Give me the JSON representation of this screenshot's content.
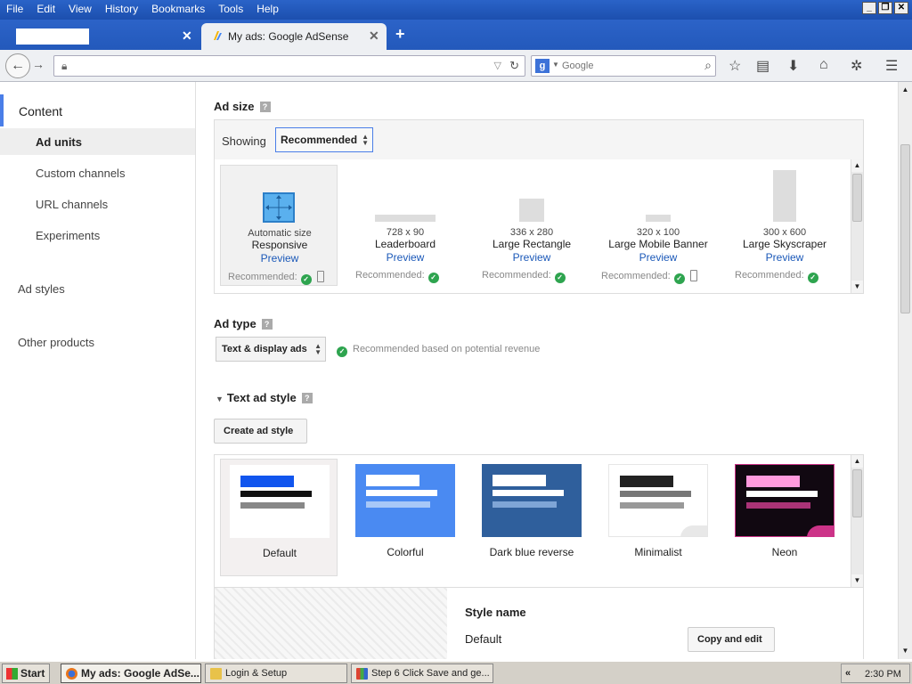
{
  "menubar": {
    "items": [
      "File",
      "Edit",
      "View",
      "History",
      "Bookmarks",
      "Tools",
      "Help"
    ],
    "window_buttons": [
      "_",
      "❐",
      "✕"
    ]
  },
  "tabs": [
    {
      "title": ""
    },
    {
      "title": "My ads: Google AdSense",
      "active": true
    }
  ],
  "toolbar": {
    "url": "",
    "search_engine": "Google",
    "search_placeholder": "Google"
  },
  "sidebar": {
    "content_label": "Content",
    "items": [
      "Ad units",
      "Custom channels",
      "URL channels",
      "Experiments"
    ],
    "top_items": [
      "Ad styles",
      "Other products"
    ]
  },
  "main": {
    "ad_size": {
      "title": "Ad size",
      "help": "?",
      "showing_label": "Showing",
      "select_value": "Recommended",
      "cards": [
        {
          "dim": "Automatic size",
          "name": "Responsive",
          "preview": "Preview",
          "rec": "Recommended:",
          "mobile": true
        },
        {
          "dim": "728 x 90",
          "name": "Leaderboard",
          "preview": "Preview",
          "rec": "Recommended:",
          "mobile": false
        },
        {
          "dim": "336 x 280",
          "name": "Large Rectangle",
          "preview": "Preview",
          "rec": "Recommended:",
          "mobile": false
        },
        {
          "dim": "320 x 100",
          "name": "Large Mobile Banner",
          "preview": "Preview",
          "rec": "Recommended:",
          "mobile": true
        },
        {
          "dim": "300 x 600",
          "name": "Large Skyscraper",
          "preview": "Preview",
          "rec": "Recommended:",
          "mobile": false
        }
      ]
    },
    "ad_type": {
      "title": "Ad type",
      "help": "?",
      "select_value": "Text & display ads",
      "note": "Recommended based on potential revenue"
    },
    "text_ad_style": {
      "title": "Text ad style",
      "help": "?",
      "create_button": "Create ad style",
      "styles": [
        {
          "label": "Default",
          "bg": "#ffffff",
          "title_color": "#1155ee",
          "line1": "#111111",
          "line2": "#888888"
        },
        {
          "label": "Colorful",
          "bg": "#4a8af2",
          "title_color": "#ffffff",
          "line1": "#ffffff",
          "line2": "#a8c8f8"
        },
        {
          "label": "Dark blue reverse",
          "bg": "#2f5f9c",
          "title_color": "#ffffff",
          "line1": "#ffffff",
          "line2": "#7fa5d6"
        },
        {
          "label": "Minimalist",
          "bg": "#ffffff",
          "title_color": "#222222",
          "line1": "#777777",
          "line2": "#999999"
        },
        {
          "label": "Neon",
          "bg": "#110811",
          "title_color": "#ff99dd",
          "line1": "#ffffff",
          "line2": "#aa3377"
        }
      ],
      "style_name_label": "Style name",
      "style_name_value": "Default",
      "copy_edit_button": "Copy and edit"
    }
  },
  "taskbar": {
    "start": "Start",
    "tasks": [
      "My ads: Google AdSe...",
      "Login & Setup",
      "Step 6 Click Save and ge..."
    ],
    "clock": "2:30 PM"
  },
  "colors": {
    "accent": "#4a7ee8",
    "link": "#1a58b8",
    "check": "#2ea44f"
  }
}
